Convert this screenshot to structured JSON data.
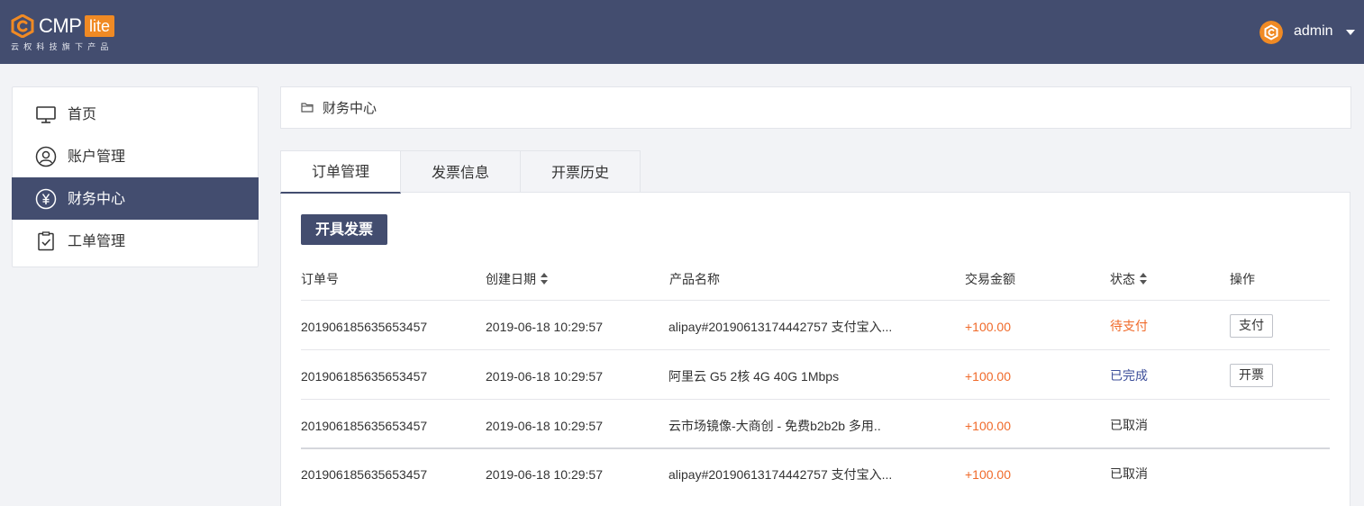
{
  "brand": {
    "name": "CMP",
    "edition": "lite",
    "tagline": "云权科技旗下产品",
    "accent": "#f08a24",
    "header_bg": "#434d6f"
  },
  "user": {
    "name": "admin",
    "avatar_icon": "user-logo-icon",
    "menu_icon": "caret-down-icon"
  },
  "sidebar": {
    "items": [
      {
        "label": "首页",
        "icon": "monitor-icon",
        "active": false
      },
      {
        "label": "账户管理",
        "icon": "user-circle-icon",
        "active": false
      },
      {
        "label": "财务中心",
        "icon": "yen-circle-icon",
        "active": true
      },
      {
        "label": "工单管理",
        "icon": "clipboard-check-icon",
        "active": false
      }
    ]
  },
  "breadcrumb": {
    "icon": "folder-icon",
    "text": "财务中心"
  },
  "tabs": [
    {
      "label": "订单管理",
      "active": true
    },
    {
      "label": "发票信息",
      "active": false
    },
    {
      "label": "开票历史",
      "active": false
    }
  ],
  "toolbar": {
    "issue_invoice_label": "开具发票"
  },
  "table": {
    "columns": [
      "订单号",
      "创建日期",
      "产品名称",
      "交易金额",
      "状态",
      "操作"
    ],
    "sortable": [
      "创建日期",
      "状态"
    ],
    "rows": [
      {
        "order_no": "201906185635653457",
        "created": "2019-06-18 10:29:57",
        "product": "alipay#20190613174442757 支付宝入...",
        "amount": "+100.00",
        "status": "待支付",
        "status_type": "pending",
        "action": "支付"
      },
      {
        "order_no": "201906185635653457",
        "created": "2019-06-18 10:29:57",
        "product": "阿里云 G5 2核 4G 40G 1Mbps",
        "amount": "+100.00",
        "status": "已完成",
        "status_type": "done",
        "action": "开票"
      },
      {
        "order_no": "201906185635653457",
        "created": "2019-06-18 10:29:57",
        "product": "云市场镜像-大商创 - 免费b2b2b 多用..",
        "amount": "+100.00",
        "status": "已取消",
        "status_type": "cancel",
        "action": ""
      },
      {
        "order_no": "201906185635653457",
        "created": "2019-06-18 10:29:57",
        "product": "alipay#20190613174442757 支付宝入...",
        "amount": "+100.00",
        "status": "已取消",
        "status_type": "cancel",
        "action": ""
      }
    ]
  },
  "colors": {
    "amount": "#f06a2a",
    "pending": "#f06a2a",
    "done": "#3d4f9a"
  }
}
